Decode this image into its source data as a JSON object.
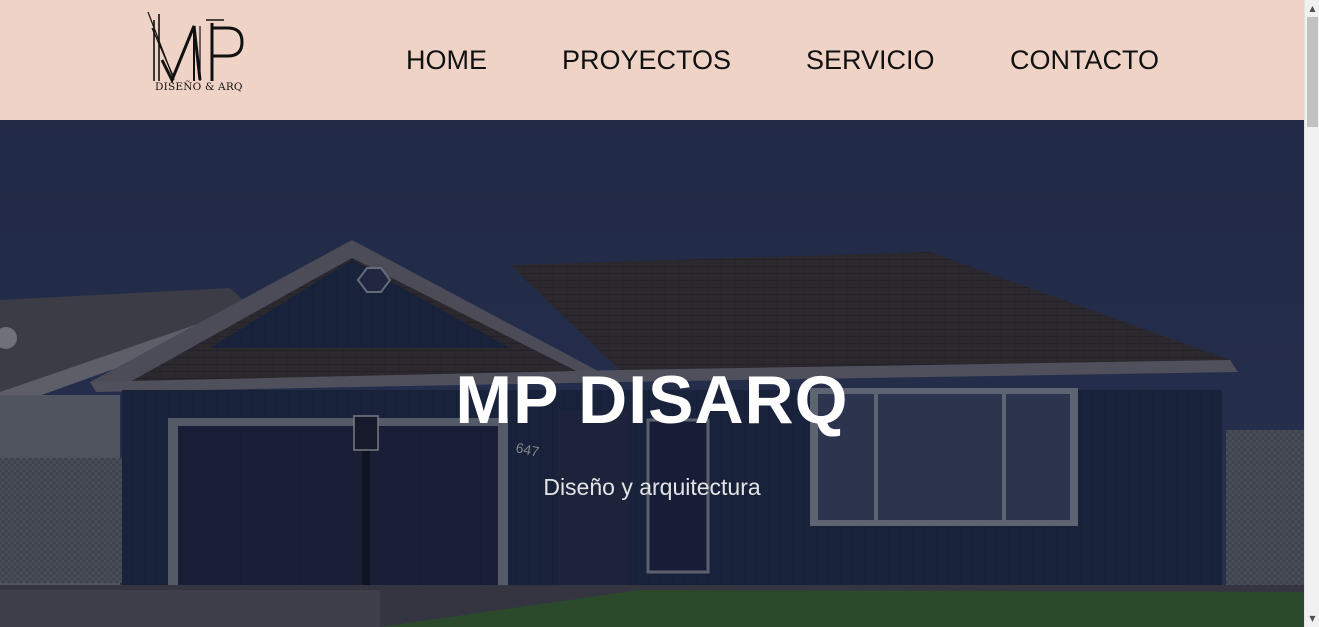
{
  "header": {
    "logo": {
      "monogram": "MP",
      "caption": "DISEÑO & ARQ"
    },
    "nav": [
      {
        "label": "HOME"
      },
      {
        "label": "PROYECTOS"
      },
      {
        "label": "SERVICIO"
      },
      {
        "label": "CONTACTO"
      }
    ]
  },
  "hero": {
    "title": "MP DISARQ",
    "subtitle": "Diseño y arquitectura",
    "house_number": "647"
  },
  "colors": {
    "header_bg": "#eed3c6",
    "nav_text": "#111111",
    "hero_title": "#ffffff",
    "hero_subtitle": "#e4e4e4"
  },
  "icons": {
    "scroll_up": "triangle-up-icon",
    "scroll_down": "triangle-down-icon"
  }
}
